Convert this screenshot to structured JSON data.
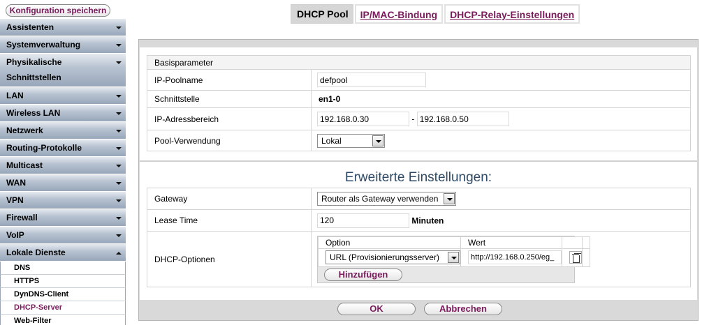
{
  "sidebar": {
    "save_label": "Konfiguration speichern",
    "items": [
      {
        "label": "Assistenten"
      },
      {
        "label": "Systemverwaltung"
      },
      {
        "label": "Physikalische Schnittstellen"
      },
      {
        "label": "LAN"
      },
      {
        "label": "Wireless LAN"
      },
      {
        "label": "Netzwerk"
      },
      {
        "label": "Routing-Protokolle"
      },
      {
        "label": "Multicast"
      },
      {
        "label": "WAN"
      },
      {
        "label": "VPN"
      },
      {
        "label": "Firewall"
      },
      {
        "label": "VoIP"
      },
      {
        "label": "Lokale Dienste"
      }
    ],
    "subitems": [
      {
        "label": "DNS"
      },
      {
        "label": "HTTPS"
      },
      {
        "label": "DynDNS-Client"
      },
      {
        "label": "DHCP-Server"
      },
      {
        "label": "Web-Filter"
      }
    ]
  },
  "tabs": [
    {
      "label": "DHCP Pool"
    },
    {
      "label": "IP/MAC-Bindung"
    },
    {
      "label": "DHCP-Relay-Einstellungen"
    }
  ],
  "basis": {
    "section_title": "Basisparameter",
    "poolname_label": "IP-Poolname",
    "poolname_value": "defpool",
    "schnittstelle_label": "Schnittstelle",
    "schnittstelle_value": "en1-0",
    "range_label": "IP-Adressbereich",
    "range_from": "192.168.0.30",
    "range_sep": "-",
    "range_to": "192.168.0.50",
    "usage_label": "Pool-Verwendung",
    "usage_value": "Lokal"
  },
  "erweitert": {
    "title": "Erweiterte Einstellungen:",
    "gateway_label": "Gateway",
    "gateway_value": "Router als Gateway verwenden",
    "lease_label": "Lease Time",
    "lease_value": "120",
    "lease_unit": "Minuten",
    "options_label": "DHCP-Optionen",
    "options_col_option": "Option",
    "options_col_value": "Wert",
    "option_row_select": "URL (Provisionierungsserver)",
    "option_row_value": "http://192.168.0.250/eg_",
    "add_label": "Hinzufügen"
  },
  "footer": {
    "ok_label": "OK",
    "cancel_label": "Abbrechen"
  }
}
